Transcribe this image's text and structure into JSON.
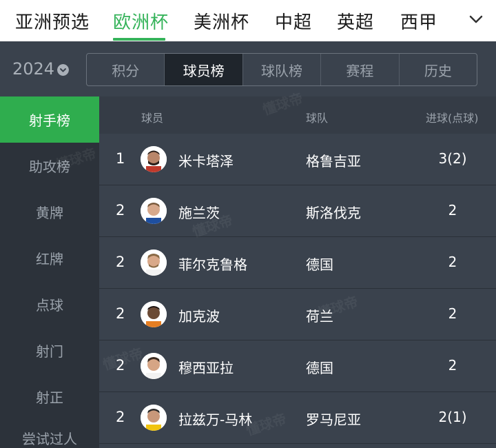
{
  "top_tabs": [
    {
      "label": "亚洲预选",
      "active": false
    },
    {
      "label": "欧洲杯",
      "active": true
    },
    {
      "label": "美洲杯",
      "active": false
    },
    {
      "label": "中超",
      "active": false
    },
    {
      "label": "英超",
      "active": false
    },
    {
      "label": "西甲",
      "active": false
    }
  ],
  "more_icon": "chevron-down-icon",
  "season": {
    "year": "2024",
    "caret_icon": "chevron-down-circle-icon"
  },
  "sub_tabs": [
    {
      "label": "积分",
      "active": false
    },
    {
      "label": "球员榜",
      "active": true
    },
    {
      "label": "球队榜",
      "active": false
    },
    {
      "label": "赛程",
      "active": false
    },
    {
      "label": "历史",
      "active": false
    }
  ],
  "sidebar": [
    {
      "label": "射手榜",
      "active": true
    },
    {
      "label": "助攻榜",
      "active": false
    },
    {
      "label": "黄牌",
      "active": false
    },
    {
      "label": "红牌",
      "active": false
    },
    {
      "label": "点球",
      "active": false
    },
    {
      "label": "射门",
      "active": false
    },
    {
      "label": "射正",
      "active": false
    },
    {
      "label": "尝试过人",
      "active": false
    }
  ],
  "table": {
    "headers": {
      "player": "球员",
      "team": "球队",
      "goals": "进球(点球)"
    },
    "rows": [
      {
        "rank": "1",
        "player": "米卡塔泽",
        "team": "格鲁吉亚",
        "goals": "3(2)"
      },
      {
        "rank": "2",
        "player": "施兰茨",
        "team": "斯洛伐克",
        "goals": "2"
      },
      {
        "rank": "2",
        "player": "菲尔克鲁格",
        "team": "德国",
        "goals": "2"
      },
      {
        "rank": "2",
        "player": "加克波",
        "team": "荷兰",
        "goals": "2"
      },
      {
        "rank": "2",
        "player": "穆西亚拉",
        "team": "德国",
        "goals": "2"
      },
      {
        "rank": "2",
        "player": "拉兹万-马林",
        "team": "罗马尼亚",
        "goals": "2(1)"
      }
    ]
  },
  "watermark": "懂球帝",
  "colors": {
    "accent": "#35b35a",
    "sidebar_active": "#2fad4e",
    "background": "#3a424d"
  }
}
